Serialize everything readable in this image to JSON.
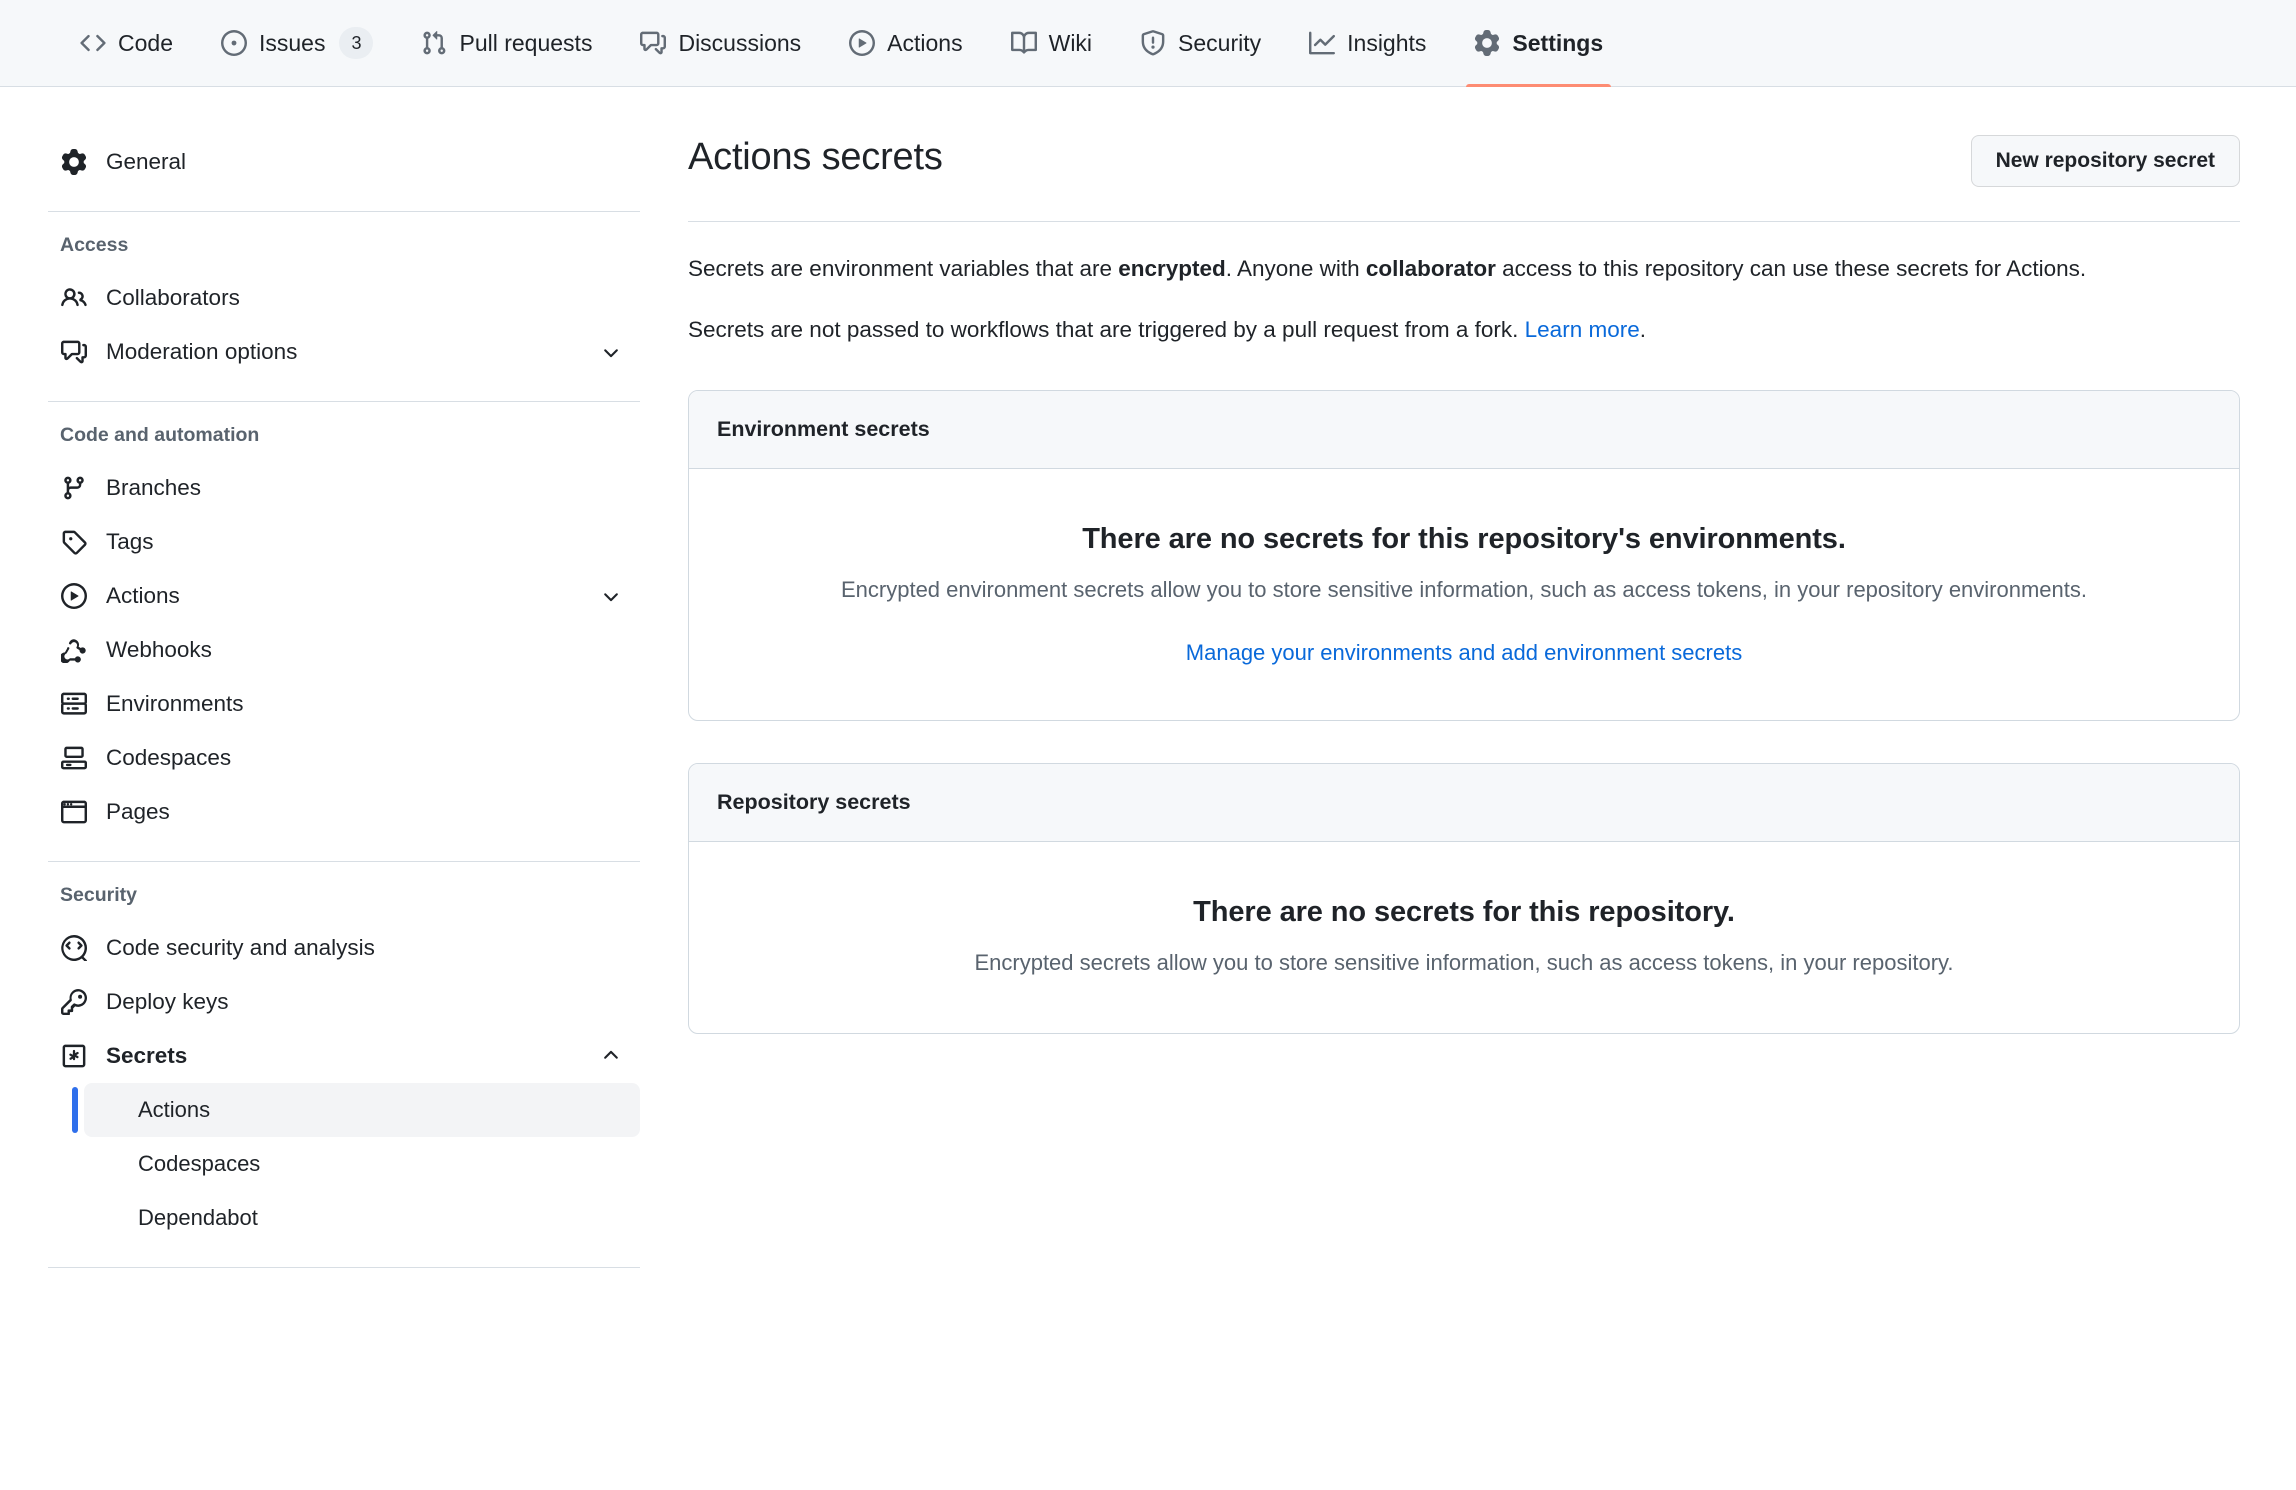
{
  "repo_nav": {
    "items": [
      {
        "label": "Code",
        "icon": "code-icon",
        "selected": false,
        "count": null
      },
      {
        "label": "Issues",
        "icon": "issue-opened-icon",
        "selected": false,
        "count": "3"
      },
      {
        "label": "Pull requests",
        "icon": "git-pull-request-icon",
        "selected": false,
        "count": null
      },
      {
        "label": "Discussions",
        "icon": "comment-discussion-icon",
        "selected": false,
        "count": null
      },
      {
        "label": "Actions",
        "icon": "play-icon",
        "selected": false,
        "count": null
      },
      {
        "label": "Wiki",
        "icon": "book-icon",
        "selected": false,
        "count": null
      },
      {
        "label": "Security",
        "icon": "shield-icon",
        "selected": false,
        "count": null
      },
      {
        "label": "Insights",
        "icon": "graph-icon",
        "selected": false,
        "count": null
      },
      {
        "label": "Settings",
        "icon": "gear-icon",
        "selected": true,
        "count": null
      }
    ],
    "selected_indicator_color": "#fd8c73"
  },
  "sidebar": {
    "general": {
      "label": "General",
      "icon": "gear-icon"
    },
    "groups": [
      {
        "title": "Access",
        "items": [
          {
            "label": "Collaborators",
            "icon": "people-icon",
            "expandable": false
          },
          {
            "label": "Moderation options",
            "icon": "comment-discussion-icon",
            "expandable": true,
            "expanded": false
          }
        ]
      },
      {
        "title": "Code and automation",
        "items": [
          {
            "label": "Branches",
            "icon": "git-branch-icon",
            "expandable": false
          },
          {
            "label": "Tags",
            "icon": "tag-icon",
            "expandable": false
          },
          {
            "label": "Actions",
            "icon": "play-icon",
            "expandable": true,
            "expanded": false
          },
          {
            "label": "Webhooks",
            "icon": "webhook-icon",
            "expandable": false
          },
          {
            "label": "Environments",
            "icon": "server-icon",
            "expandable": false
          },
          {
            "label": "Codespaces",
            "icon": "codespaces-icon",
            "expandable": false
          },
          {
            "label": "Pages",
            "icon": "browser-icon",
            "expandable": false
          }
        ]
      },
      {
        "title": "Security",
        "items": [
          {
            "label": "Code security and analysis",
            "icon": "codescan-icon",
            "expandable": false
          },
          {
            "label": "Deploy keys",
            "icon": "key-icon",
            "expandable": false
          },
          {
            "label": "Secrets",
            "icon": "secrets-asterisk-icon",
            "expandable": true,
            "expanded": true,
            "bold": true
          }
        ]
      }
    ],
    "secrets_subitems": [
      {
        "label": "Actions",
        "selected": true
      },
      {
        "label": "Codespaces",
        "selected": false
      },
      {
        "label": "Dependabot",
        "selected": false
      }
    ],
    "selected_accent_color": "#2f6feb"
  },
  "main": {
    "title": "Actions secrets",
    "new_secret_button": "New repository secret",
    "intro": {
      "p1_part1": "Secrets are environment variables that are ",
      "p1_bold1": "encrypted",
      "p1_part2": ". Anyone with ",
      "p1_bold2": "collaborator",
      "p1_part3": " access to this repository can use these secrets for Actions.",
      "p2_text": "Secrets are not passed to workflows that are triggered by a pull request from a fork. ",
      "p2_link": "Learn more",
      "p2_end": "."
    },
    "environment_secrets": {
      "header": "Environment secrets",
      "blank_title": "There are no secrets for this repository's environments.",
      "blank_desc": "Encrypted environment secrets allow you to store sensitive information, such as access tokens, in your repository environments.",
      "blank_link": "Manage your environments and add environment secrets"
    },
    "repository_secrets": {
      "header": "Repository secrets",
      "blank_title": "There are no secrets for this repository.",
      "blank_desc": "Encrypted secrets allow you to store sensitive information, such as access tokens, in your repository."
    }
  }
}
